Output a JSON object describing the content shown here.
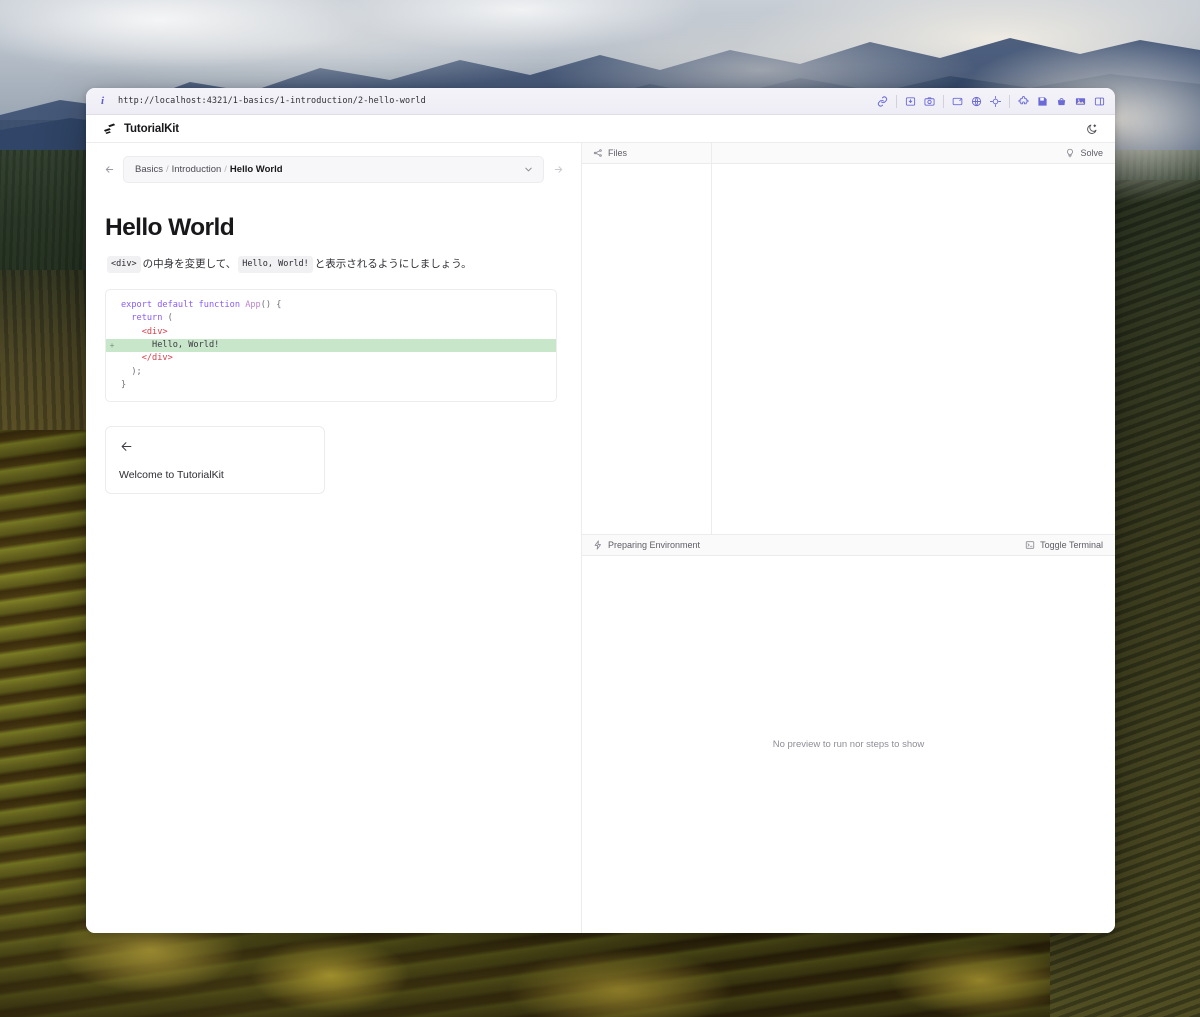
{
  "browser": {
    "url": "http://localhost:4321/1-basics/1-introduction/2-hello-world",
    "info_icon": "info-icon",
    "toolbar_icons": [
      {
        "name": "link-icon",
        "label": "Link"
      },
      {
        "name": "screenshot-region-icon",
        "label": "Capture region"
      },
      {
        "name": "camera-icon",
        "label": "Screenshot"
      },
      {
        "name": "window-icon",
        "label": "Window"
      },
      {
        "name": "globe-icon",
        "label": "Network"
      },
      {
        "name": "target-icon",
        "label": "Inspect element"
      },
      {
        "name": "puzzle-icon",
        "label": "Extensions"
      },
      {
        "name": "save-icon",
        "label": "Save"
      },
      {
        "name": "bag-icon",
        "label": "Collection"
      },
      {
        "name": "image-icon",
        "label": "Media"
      },
      {
        "name": "sidebar-icon",
        "label": "Toggle sidebar"
      }
    ]
  },
  "header": {
    "logo_icon": "tutorialkit-logo-icon",
    "title": "TutorialKit",
    "theme_toggle_icon": "moon-icon"
  },
  "nav": {
    "back_icon": "arrow-left-icon",
    "forward_icon": "arrow-right-icon",
    "chevron_icon": "chevron-down-icon",
    "breadcrumb": {
      "part1": "Basics",
      "part2": "Introduction",
      "current": "Hello World",
      "separator": "/"
    }
  },
  "lesson": {
    "title": "Hello World",
    "paragraph": {
      "code1": "<div>",
      "text1": "の中身を変更して、",
      "code2": "Hello, World!",
      "text2": "と表示されるようにしましょう。"
    },
    "code": {
      "lines": [
        {
          "gutter": "",
          "added": false,
          "tokens": [
            {
              "t": "export ",
              "c": "kw"
            },
            {
              "t": "default ",
              "c": "kw"
            },
            {
              "t": "function ",
              "c": "kw"
            },
            {
              "t": "App",
              "c": "fn"
            },
            {
              "t": "() {",
              "c": "pun"
            }
          ]
        },
        {
          "gutter": "",
          "added": false,
          "tokens": [
            {
              "t": "  ",
              "c": "pun"
            },
            {
              "t": "return",
              "c": "kw"
            },
            {
              "t": " (",
              "c": "pun"
            }
          ]
        },
        {
          "gutter": "",
          "added": false,
          "tokens": [
            {
              "t": "    ",
              "c": "pun"
            },
            {
              "t": "<div>",
              "c": "tag"
            }
          ]
        },
        {
          "gutter": "+",
          "added": true,
          "tokens": [
            {
              "t": "      Hello, World!",
              "c": "str"
            }
          ]
        },
        {
          "gutter": "",
          "added": false,
          "tokens": [
            {
              "t": "    ",
              "c": "pun"
            },
            {
              "t": "</div>",
              "c": "tag"
            }
          ]
        },
        {
          "gutter": "",
          "added": false,
          "tokens": [
            {
              "t": "  );",
              "c": "pun"
            }
          ]
        },
        {
          "gutter": "",
          "added": false,
          "tokens": [
            {
              "t": "}",
              "c": "pun"
            }
          ]
        }
      ]
    },
    "prev_card": {
      "arrow_icon": "arrow-left-icon",
      "label": "Welcome to TutorialKit"
    }
  },
  "workspace": {
    "files_panel": {
      "icon": "files-tree-icon",
      "label": "Files"
    },
    "solve": {
      "icon": "lightbulb-icon",
      "label": "Solve"
    },
    "terminal": {
      "status_icon": "bolt-icon",
      "status": "Preparing Environment",
      "toggle_icon": "terminal-icon",
      "toggle_label": "Toggle Terminal"
    },
    "preview": {
      "empty_message": "No preview to run nor steps to show"
    }
  },
  "colors": {
    "accent_purple": "#8b5cf6",
    "diff_add_bg": "#c8e6c9",
    "tag_red": "#d43f4a",
    "chrome_icon": "#6b6bd8"
  }
}
